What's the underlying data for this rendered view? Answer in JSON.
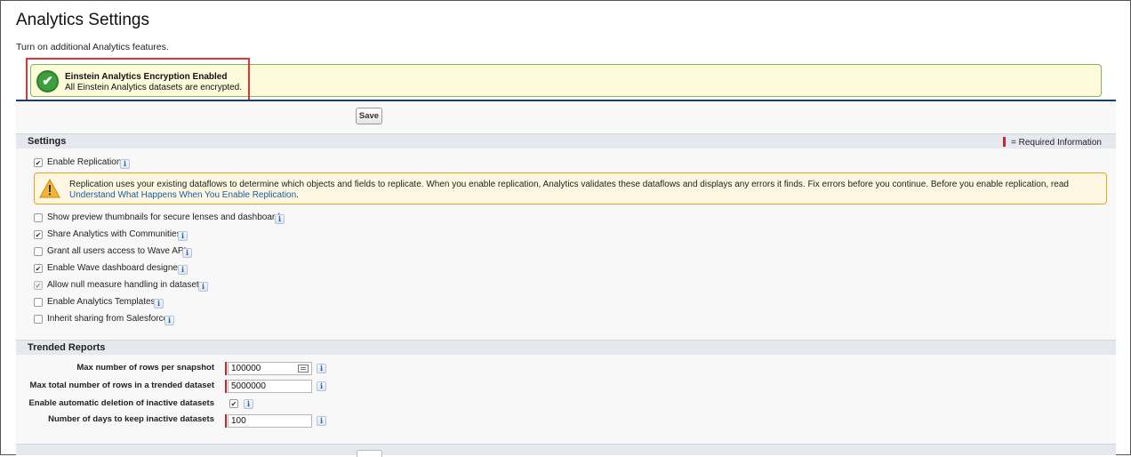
{
  "page": {
    "title": "Analytics Settings",
    "subtitle": "Turn on additional Analytics features."
  },
  "confirmation": {
    "title": "Einstein Analytics Encryption Enabled",
    "message": "All Einstein Analytics datasets are encrypted.",
    "icon": "checkmark-icon"
  },
  "toolbar": {
    "save_label": "Save"
  },
  "settings": {
    "header": "Settings",
    "required_legend": "= Required Information",
    "enable_replication": {
      "label": "Enable Replication",
      "checked": true
    },
    "warning": {
      "text": "Replication uses your existing dataflows to determine which objects and fields to replicate. When you enable replication, Analytics validates these dataflows and displays any errors it finds. Fix errors before you continue. Before you enable replication, read ",
      "link": "Understand What Happens When You Enable Replication",
      "suffix": "."
    },
    "options": [
      {
        "label": "Show preview thumbnails for secure lenses and dashboards",
        "checked": false,
        "disabled": false
      },
      {
        "label": "Share Analytics with Communities",
        "checked": true,
        "disabled": false
      },
      {
        "label": "Grant all users access to Wave API",
        "checked": false,
        "disabled": false
      },
      {
        "label": "Enable Wave dashboard designer",
        "checked": true,
        "disabled": false
      },
      {
        "label": "Allow null measure handling in datasets",
        "checked": true,
        "disabled": true
      },
      {
        "label": "Enable Analytics Templates",
        "checked": false,
        "disabled": false
      },
      {
        "label": "Inherit sharing from Salesforce",
        "checked": false,
        "disabled": false
      }
    ]
  },
  "trended_reports": {
    "header": "Trended Reports",
    "max_rows_snapshot": {
      "label": "Max number of rows per snapshot",
      "value": "100000"
    },
    "max_total_rows": {
      "label": "Max total number of rows in a trended dataset",
      "value": "5000000"
    },
    "auto_delete": {
      "label": "Enable automatic deletion of inactive datasets",
      "checked": true
    },
    "days_keep": {
      "label": "Number of days to keep inactive datasets",
      "value": "100"
    }
  },
  "info_label": "i",
  "colors": {
    "required": "#c2262e",
    "confirm_bg": "#fdfbd9",
    "warning_border": "#f0a020",
    "link": "#1a5ca8",
    "header_rule": "#1d3a6e"
  }
}
